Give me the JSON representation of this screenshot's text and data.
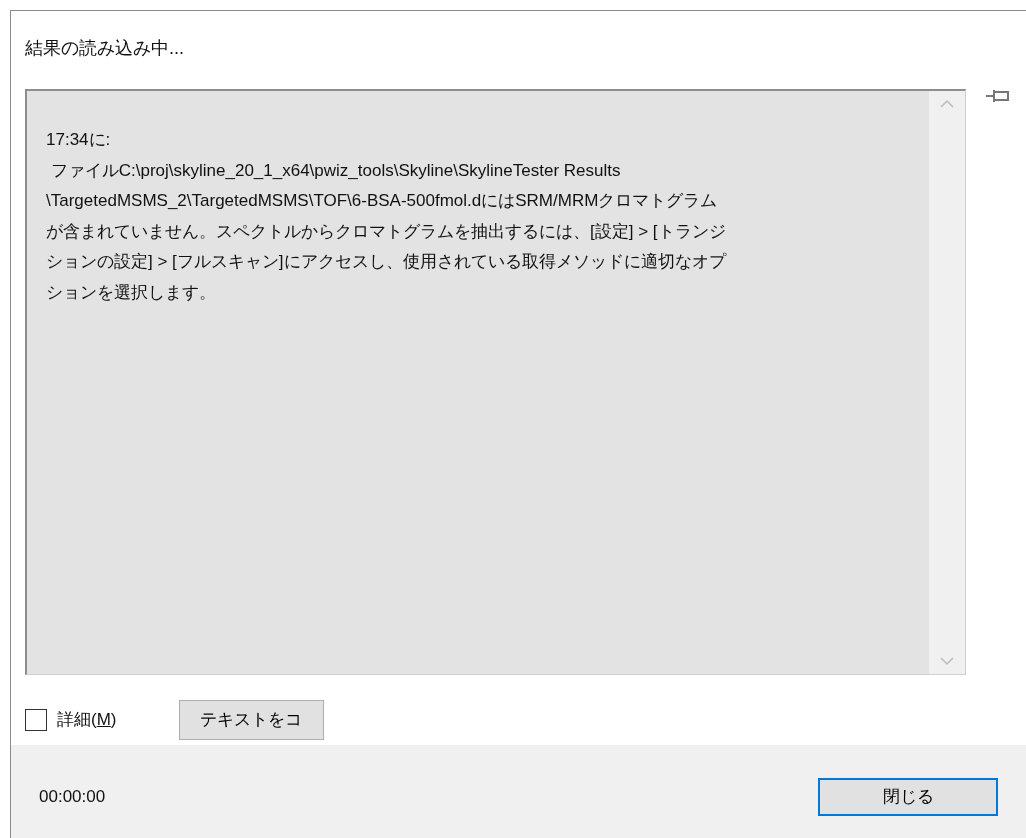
{
  "window": {
    "title": "結果の読み込み中..."
  },
  "message": {
    "lines": [
      "17:34に:",
      " ファイルC:\\proj\\skyline_20_1_x64\\pwiz_tools\\Skyline\\SkylineTester Results",
      "\\TargetedMSMS_2\\TargetedMSMS\\TOF\\6-BSA-500fmol.dにはSRM/MRMクロマトグラム",
      "が含まれていません。スペクトルからクロマトグラムを抽出するには、[設定] > [トランジ",
      "ションの設定] > [フルスキャン]にアクセスし、使用されている取得メソッドに適切なオプ",
      "ションを選択します。"
    ]
  },
  "details_checkbox": {
    "label_prefix": "詳細(",
    "mnemonic": "M",
    "label_suffix": ")",
    "checked": false
  },
  "copy_button": {
    "label": "テキストをコ"
  },
  "status": {
    "elapsed": "00:00:00"
  },
  "close_button": {
    "label": "閉じる",
    "default": true
  }
}
